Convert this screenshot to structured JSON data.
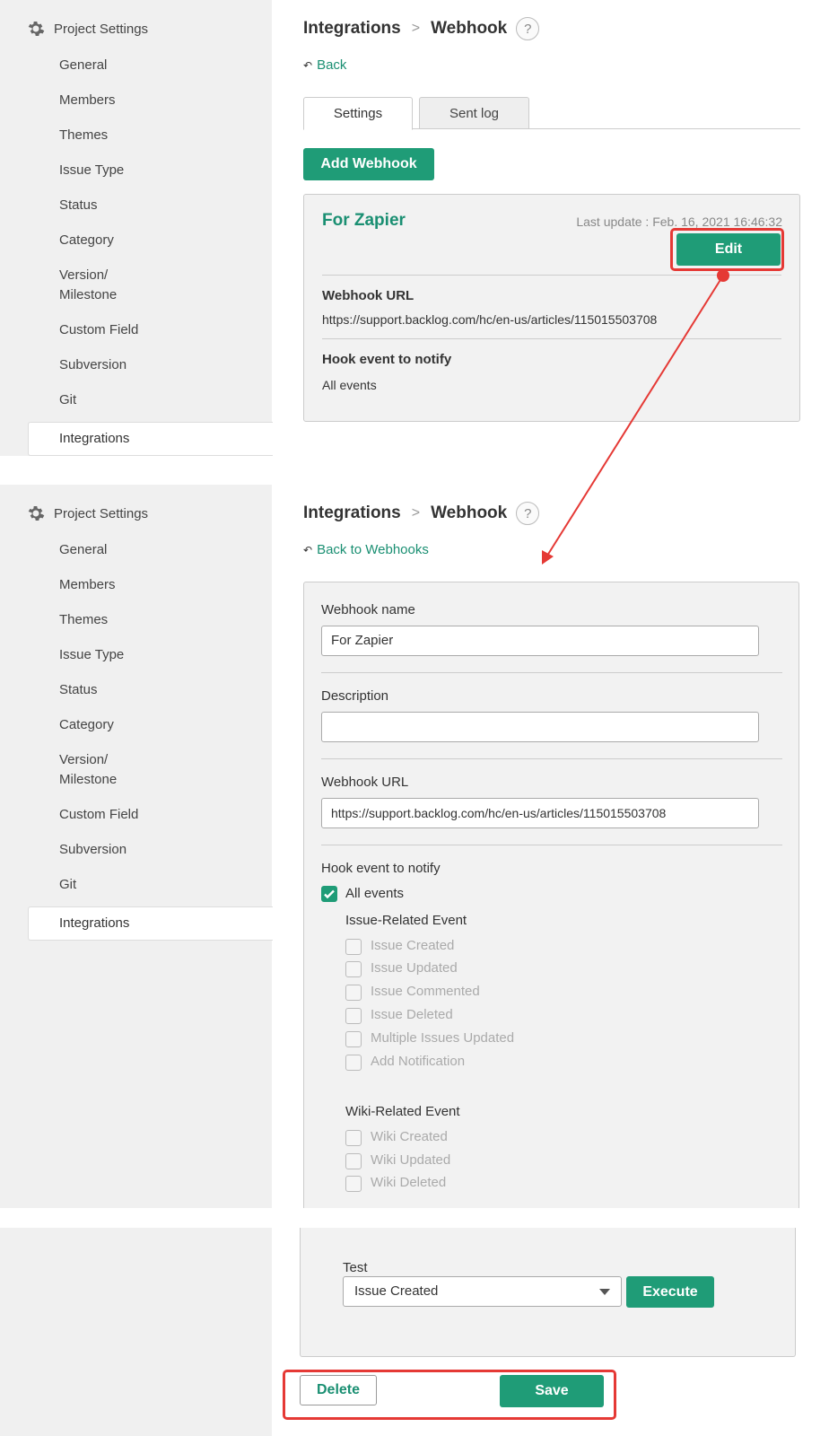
{
  "sidebar": {
    "header": "Project Settings",
    "items": [
      "General",
      "Members",
      "Themes",
      "Issue Type",
      "Status",
      "Category",
      "Version/",
      "Milestone",
      "Custom Field",
      "Subversion",
      "Git"
    ],
    "active": "Integrations"
  },
  "breadcrumb": {
    "parent": "Integrations",
    "current": "Webhook",
    "help": "?"
  },
  "top": {
    "back": "Back",
    "tabs": [
      "Settings",
      "Sent log"
    ],
    "add_button": "Add Webhook",
    "webhook": {
      "name": "For Zapier",
      "last_update": "Last update : Feb. 16, 2021 16:46:32",
      "edit_button": "Edit",
      "url_label": "Webhook URL",
      "url": "https://support.backlog.com/hc/en-us/articles/115015503708",
      "event_label": "Hook event to notify",
      "event_value": "All events"
    }
  },
  "edit": {
    "back": "Back to Webhooks",
    "name_label": "Webhook name",
    "name_value": "For Zapier",
    "desc_label": "Description",
    "desc_value": "",
    "url_label": "Webhook URL",
    "url_value": "https://support.backlog.com/hc/en-us/articles/115015503708",
    "event_label": "Hook event to notify",
    "all_events": "All events",
    "issue_group": "Issue-Related Event",
    "issue_events": [
      "Issue Created",
      "Issue Updated",
      "Issue Commented",
      "Issue Deleted",
      "Multiple Issues Updated",
      "Add Notification"
    ],
    "wiki_group": "Wiki-Related Event",
    "wiki_events": [
      "Wiki Created",
      "Wiki Updated",
      "Wiki Deleted"
    ]
  },
  "bottom": {
    "test_label": "Test",
    "test_selected": "Issue Created",
    "execute": "Execute",
    "delete": "Delete",
    "save": "Save"
  },
  "colors": {
    "accent": "#1f9c77",
    "highlight": "#e53935",
    "sidebar_bg": "#f0f0f0"
  }
}
